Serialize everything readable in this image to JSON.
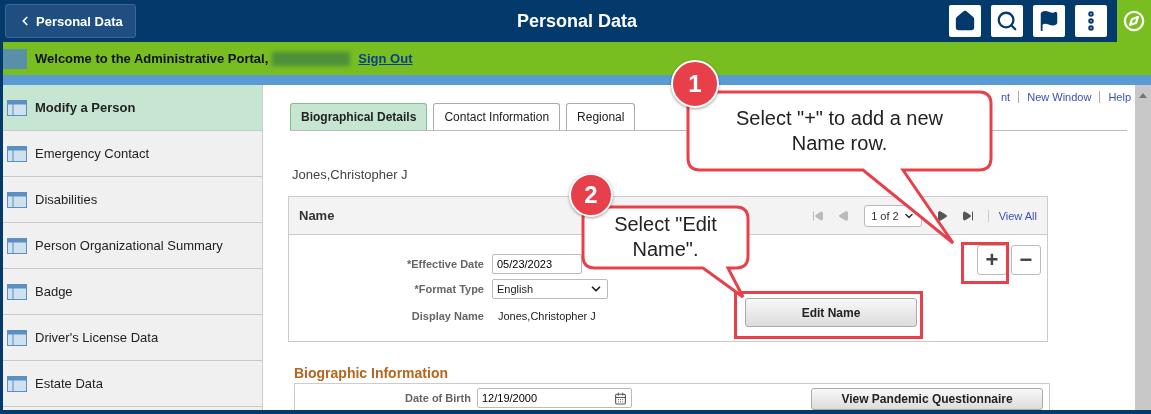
{
  "header": {
    "back": "Personal Data",
    "title": "Personal Data"
  },
  "welcome": {
    "text": "Welcome to the Administrative Portal,",
    "sign_out": "Sign Out"
  },
  "sidebar": {
    "items": [
      {
        "label": "Modify a Person",
        "selected": true
      },
      {
        "label": "Emergency Contact",
        "selected": false
      },
      {
        "label": "Disabilities",
        "selected": false
      },
      {
        "label": "Person Organizational Summary",
        "selected": false
      },
      {
        "label": "Badge",
        "selected": false
      },
      {
        "label": "Driver's License Data",
        "selected": false
      },
      {
        "label": "Estate Data",
        "selected": false
      }
    ]
  },
  "tabs": [
    {
      "label": "Biographical Details",
      "selected": true
    },
    {
      "label": "Contact Information",
      "selected": false
    },
    {
      "label": "Regional",
      "selected": false
    }
  ],
  "links": [
    "nt",
    "New Window",
    "Help"
  ],
  "person_name": "Jones,Christopher J",
  "name_panel": {
    "title": "Name",
    "page": "1 of 2",
    "view_all": "View All",
    "add": "+",
    "remove": "−",
    "fields": [
      {
        "kind": "input",
        "label": "*Effective Date",
        "value": "05/23/2023"
      },
      {
        "kind": "select",
        "label": "*Format Type",
        "value": "English"
      },
      {
        "kind": "text",
        "label": "Display Name",
        "value": "Jones,Christopher J"
      }
    ],
    "edit_button": "Edit Name"
  },
  "bio": {
    "title": "Biographic Information",
    "dob_label": "Date of Birth",
    "dob": "12/19/2000",
    "button": "View Pandemic Questionnaire"
  },
  "callouts": [
    {
      "number": "1",
      "text": "Select \"+\" to add a new Name row."
    },
    {
      "number": "2",
      "text": "Select \"Edit Name\"."
    }
  ]
}
